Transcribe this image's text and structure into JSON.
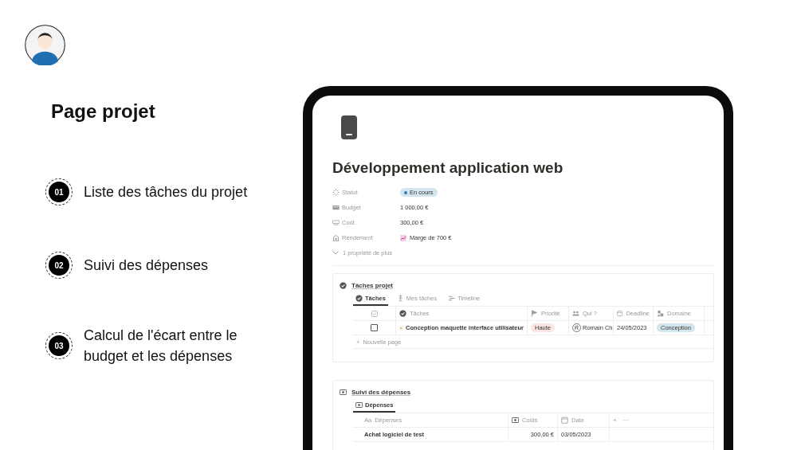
{
  "heading": "Page projet",
  "features": [
    {
      "number": "01",
      "text": "Liste des tâches du projet"
    },
    {
      "number": "02",
      "text": "Suivi des dépenses"
    },
    {
      "number": "03",
      "text": "Calcul de l'écart entre le budget et les dépenses"
    }
  ],
  "page": {
    "title": "Développement application web",
    "properties": [
      {
        "kind": "status",
        "label": "Statut",
        "value": "En cours"
      },
      {
        "kind": "budget",
        "label": "Budget",
        "value": "1 000,00 €"
      },
      {
        "kind": "cost",
        "label": "Coût",
        "value": "300,00 €"
      },
      {
        "kind": "yield",
        "label": "Rendement",
        "value": "Marge de 700 €"
      }
    ],
    "more_properties": "1 propriété de plus",
    "tasks": {
      "title": "Tâches projet",
      "views": [
        {
          "kind": "check",
          "label": "Tâches",
          "selected": true
        },
        {
          "kind": "person",
          "label": "Mes tâches",
          "selected": false
        },
        {
          "kind": "timeline",
          "label": "Timeline",
          "selected": false
        }
      ],
      "columns": [
        {
          "kind": "check",
          "label": "Tâches"
        },
        {
          "kind": "flag",
          "label": "Priorité"
        },
        {
          "kind": "people",
          "label": "Qui ?"
        },
        {
          "kind": "calendar",
          "label": "Deadline"
        },
        {
          "kind": "shapes",
          "label": "Domaine"
        }
      ],
      "rows": [
        {
          "done": false,
          "name": "Conception maquette interface utilisateur",
          "priority": "Haute",
          "assignee_initial": "R",
          "assignee": "Romain Ch",
          "deadline": "24/05/2023",
          "domain": "Conception"
        }
      ],
      "new_row_icon": "+",
      "new_row": "Nouvelle page"
    },
    "expenses": {
      "title": "Suivi des dépenses",
      "views": [
        {
          "label": "Dépenses",
          "selected": true
        }
      ],
      "columns": [
        {
          "prefix": "Aa",
          "label": "Dépenses"
        },
        {
          "kind": "money",
          "label": "Coûts"
        },
        {
          "kind": "calendar",
          "label": "Date"
        }
      ],
      "add_column": "+",
      "more": "···",
      "rows": [
        {
          "name": "Achat logiciel de test",
          "cost": "300,00 €",
          "date": "03/05/2023"
        }
      ]
    }
  }
}
